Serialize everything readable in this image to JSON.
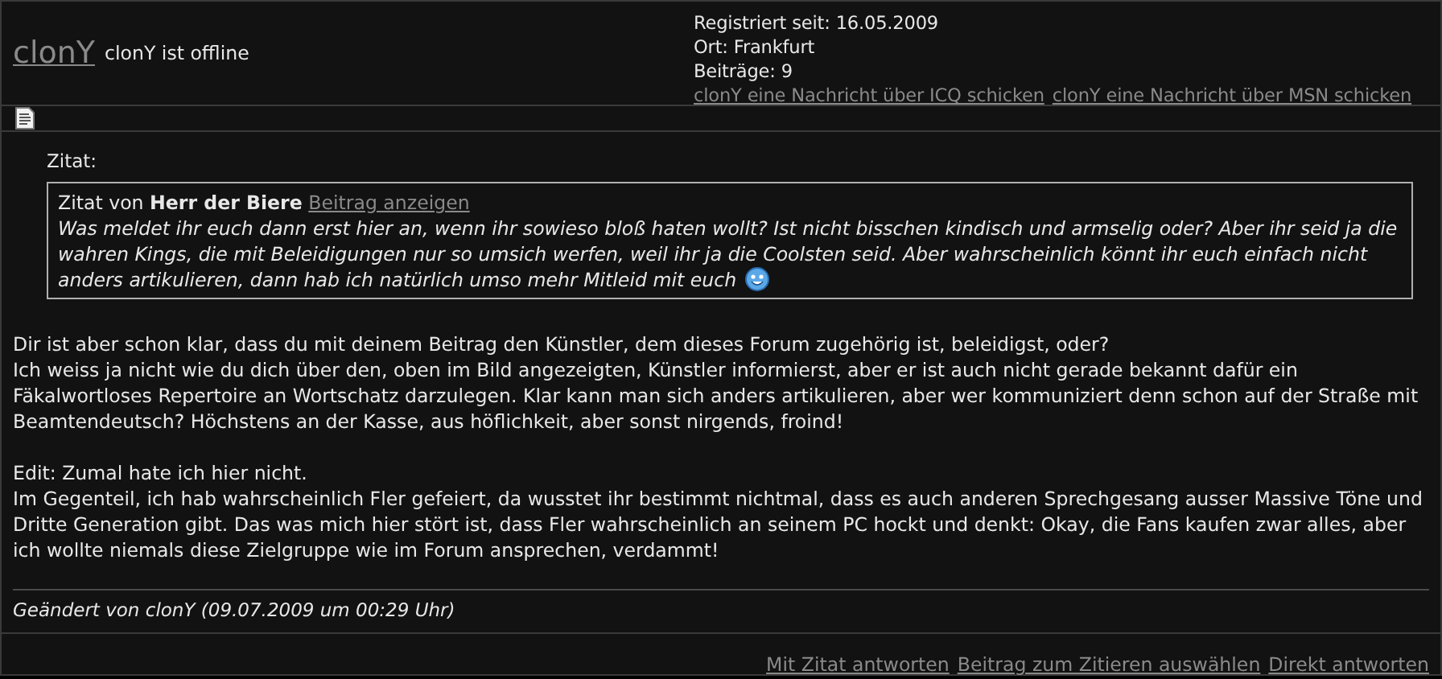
{
  "user": {
    "name": "clonY",
    "status": "clonY ist offline",
    "info": [
      "Registriert seit: 16.05.2009",
      "Ort: Frankfurt",
      "Beiträge: 9"
    ],
    "contact_links": [
      "clonY eine Nachricht über ICQ schicken",
      "clonY eine Nachricht über MSN schicken"
    ]
  },
  "quote": {
    "label": "Zitat:",
    "prefix": "Zitat von",
    "author": "Herr der Biere",
    "link": "Beitrag anzeigen",
    "text": "Was meldet ihr euch dann erst hier an, wenn ihr sowieso bloß haten wollt? Ist nicht bisschen kindisch und armselig oder? Aber ihr seid ja die wahren Kings, die mit Beleidigungen nur so umsich werfen, weil ihr ja die Coolsten seid. Aber wahrscheinlich könnt ihr euch einfach nicht anders artikulieren, dann hab ich natürlich umso mehr Mitleid mit euch"
  },
  "body": [
    [
      "Dir ist aber schon klar, dass du mit deinem Beitrag den Künstler, dem dieses Forum zugehörig ist, beleidigst, oder?",
      "Ich weiss ja nicht wie du dich über den, oben im Bild angezeigten, Künstler informierst, aber er ist auch nicht gerade bekannt dafür ein Fäkalwortloses Repertoire an Wortschatz darzulegen. Klar kann man sich anders artikulieren, aber wer kommuniziert denn schon auf der Straße mit Beamtendeutsch? Höchstens an der Kasse, aus höflichkeit, aber sonst nirgends, froind!"
    ],
    [
      "Edit: Zumal hate ich hier nicht.",
      "Im Gegenteil, ich hab wahrscheinlich Fler gefeiert, da wusstet ihr bestimmt nichtmal, dass es auch anderen Sprechgesang ausser Massive Töne und Dritte Generation gibt. Das was mich hier stört ist, dass Fler wahrscheinlich an seinem PC hockt und denkt: Okay, die Fans kaufen zwar alles, aber ich wollte niemals diese Zielgruppe wie im Forum ansprechen, verdammt!"
    ]
  ],
  "edited": "Geändert von clonY (09.07.2009 um 00:29 Uhr)",
  "actions": [
    "Mit Zitat antworten",
    "Beitrag zum Zitieren auswählen",
    "Direkt antworten"
  ]
}
